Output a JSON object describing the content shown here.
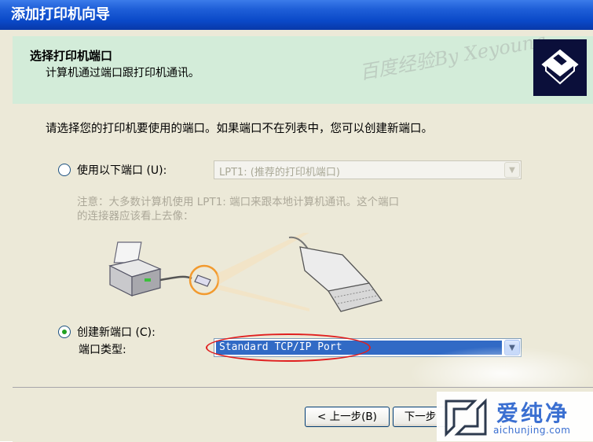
{
  "window": {
    "title": "添加打印机向导"
  },
  "header": {
    "title": "选择打印机端口",
    "subtitle": "计算机通过端口跟打印机通讯。",
    "watermark": "百度经验By Xeyoung"
  },
  "body": {
    "instruction": "请选择您的打印机要使用的端口。如果端口不在列表中，您可以创建新端口。",
    "use_port": {
      "label": "使用以下端口 (U):",
      "selected": "LPT1: (推荐的打印机端口)",
      "checked": false
    },
    "note_line1": "注意：大多数计算机使用 LPT1: 端口来跟本地计算机通讯。这个端口",
    "note_line2": "的连接器应该看上去像：",
    "create_port": {
      "label": "创建新端口 (C):",
      "type_label": "端口类型:",
      "selected": "Standard TCP/IP Port",
      "checked": true
    }
  },
  "buttons": {
    "back": "< 上一步(B)",
    "next": "下一步"
  },
  "logo": {
    "text": "爱纯净",
    "url": "aichunjing.com"
  },
  "colors": {
    "title_bar": "#0a49c8",
    "header_bg": "#d3ecd9",
    "dialog_bg": "#ece9d8",
    "selection": "#316ac5",
    "highlight_circle": "#e02020"
  }
}
